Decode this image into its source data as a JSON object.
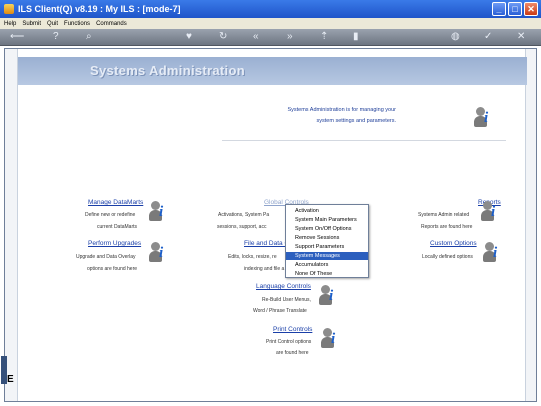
{
  "window": {
    "title": "ILS Client(Q) v8.19 : My ILS :      [mode-7]",
    "buttons": [
      "_",
      "□",
      "✕"
    ]
  },
  "menu": {
    "items": [
      "Help",
      "Submit",
      "Quit",
      "Functions",
      "Commands"
    ]
  },
  "toolbar": {
    "icons": [
      "back-arrow-icon",
      "help-icon",
      "search-icon",
      "heart-icon",
      "refresh-icon",
      "rewind-icon",
      "fast-forward-icon",
      "upload-icon",
      "stop-icon",
      "globe-icon",
      "check-icon",
      "close-icon"
    ]
  },
  "banner": {
    "title": "Systems Administration"
  },
  "intro": {
    "line1": "Systems Administration is for managing your",
    "line2": "system settings and parameters."
  },
  "sections": {
    "manage_datamarts": {
      "title": "Manage DataMarts",
      "line1": "Define new or redefine",
      "line2": "current DataMarts"
    },
    "global_controls": {
      "title": "Global Controls",
      "line1": "Activations, System Pa",
      "line2": "sessions, support, acc"
    },
    "reports": {
      "title": "Reports",
      "line1": "Systems Admin related",
      "line2": "Reports are found here"
    },
    "perform_upgrades": {
      "title": "Perform Upgrades",
      "line1": "Upgrade and Data Overlay",
      "line2": "options are found here"
    },
    "file_data": {
      "title": "File and Data C",
      "line1": "Edits, locks, resize, re",
      "line2": "indexing and file a"
    },
    "custom_options": {
      "title": "Custom Options",
      "line1": "Locally defined options"
    },
    "language_controls": {
      "title": "Language Controls",
      "line1": "Re-Build User Menus,",
      "line2": "Word / Phrase Translate"
    },
    "print_controls": {
      "title": "Print Controls",
      "line1": "Print Control options",
      "line2": "are found here"
    }
  },
  "dropdown": {
    "items": [
      "Activation",
      "System Main Parameters",
      "System On/Off Options",
      "Remove Sessions",
      "Support Parameters",
      "System Messages",
      "Accumulators",
      "None Of These"
    ],
    "selected": "System Messages"
  },
  "sidebar": {
    "letter": "E"
  },
  "colors": {
    "titlebar": "#1f55c9",
    "link": "#1a3fa8",
    "selection": "#2c5fbe"
  }
}
